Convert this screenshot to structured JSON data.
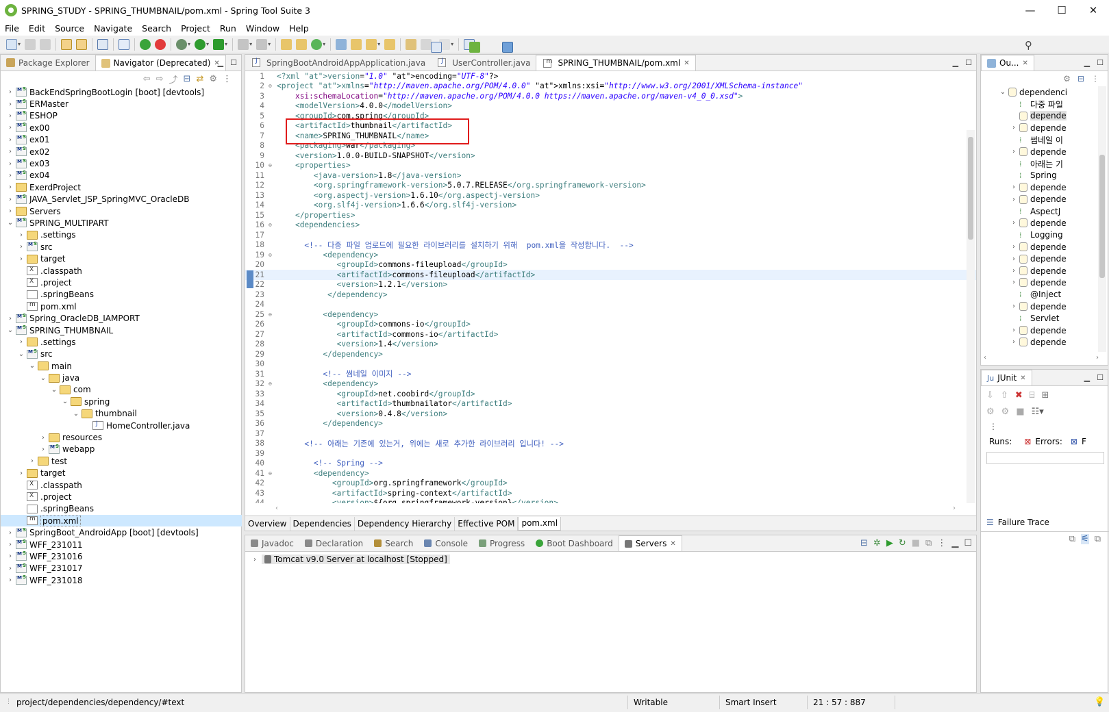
{
  "window": {
    "title": "SPRING_STUDY - SPRING_THUMBNAIL/pom.xml - Spring Tool Suite 3",
    "minimize": "—",
    "maximize": "☐",
    "close": "✕"
  },
  "menu": [
    "File",
    "Edit",
    "Source",
    "Navigate",
    "Search",
    "Project",
    "Run",
    "Window",
    "Help"
  ],
  "left_panel": {
    "tabs": [
      {
        "label": "Package Explorer",
        "active": false
      },
      {
        "label": "Navigator (Deprecated)",
        "active": true
      }
    ],
    "tree": [
      {
        "label": "BackEndSpringBootLogin [boot] [devtools]",
        "level": 0,
        "expand": "›",
        "icon": "project-icon"
      },
      {
        "label": "ERMaster",
        "level": 0,
        "expand": "›",
        "icon": "project-icon"
      },
      {
        "label": "ESHOP",
        "level": 0,
        "expand": "›",
        "icon": "project-icon"
      },
      {
        "label": "ex00",
        "level": 0,
        "expand": "›",
        "icon": "project-icon"
      },
      {
        "label": "ex01",
        "level": 0,
        "expand": "›",
        "icon": "project-icon"
      },
      {
        "label": "ex02",
        "level": 0,
        "expand": "›",
        "icon": "project-icon"
      },
      {
        "label": "ex03",
        "level": 0,
        "expand": "›",
        "icon": "project-icon"
      },
      {
        "label": "ex04",
        "level": 0,
        "expand": "›",
        "icon": "project-icon"
      },
      {
        "label": "ExerdProject",
        "level": 0,
        "expand": "›",
        "icon": "folder-icon"
      },
      {
        "label": "JAVA_Servlet_JSP_SpringMVC_OracleDB",
        "level": 0,
        "expand": "›",
        "icon": "project-icon"
      },
      {
        "label": "Servers",
        "level": 0,
        "expand": "›",
        "icon": "folder-icon"
      },
      {
        "label": "SPRING_MULTIPART",
        "level": 0,
        "expand": "⌄",
        "icon": "project-icon"
      },
      {
        "label": ".settings",
        "level": 1,
        "expand": "›",
        "icon": "folder-icon"
      },
      {
        "label": "src",
        "level": 1,
        "expand": "›",
        "icon": "project-icon"
      },
      {
        "label": "target",
        "level": 1,
        "expand": "›",
        "icon": "folder-icon"
      },
      {
        "label": ".classpath",
        "level": 1,
        "expand": "",
        "icon": "xml-file-icon"
      },
      {
        "label": ".project",
        "level": 1,
        "expand": "",
        "icon": "xml-file-icon"
      },
      {
        "label": ".springBeans",
        "level": 1,
        "expand": "",
        "icon": "text-file-icon"
      },
      {
        "label": "pom.xml",
        "level": 1,
        "expand": "",
        "icon": "maven-file-icon"
      },
      {
        "label": "Spring_OracleDB_IAMPORT",
        "level": 0,
        "expand": "›",
        "icon": "project-icon"
      },
      {
        "label": "SPRING_THUMBNAIL",
        "level": 0,
        "expand": "⌄",
        "icon": "project-icon"
      },
      {
        "label": ".settings",
        "level": 1,
        "expand": "›",
        "icon": "folder-icon"
      },
      {
        "label": "src",
        "level": 1,
        "expand": "⌄",
        "icon": "project-icon"
      },
      {
        "label": "main",
        "level": 2,
        "expand": "⌄",
        "icon": "folder-icon"
      },
      {
        "label": "java",
        "level": 3,
        "expand": "⌄",
        "icon": "folder-icon"
      },
      {
        "label": "com",
        "level": 4,
        "expand": "⌄",
        "icon": "folder-icon"
      },
      {
        "label": "spring",
        "level": 5,
        "expand": "⌄",
        "icon": "folder-icon"
      },
      {
        "label": "thumbnail",
        "level": 6,
        "expand": "⌄",
        "icon": "folder-icon"
      },
      {
        "label": "HomeController.java",
        "level": 7,
        "expand": "",
        "icon": "java-file-icon"
      },
      {
        "label": "resources",
        "level": 3,
        "expand": "›",
        "icon": "folder-icon"
      },
      {
        "label": "webapp",
        "level": 3,
        "expand": "›",
        "icon": "project-icon"
      },
      {
        "label": "test",
        "level": 2,
        "expand": "›",
        "icon": "folder-icon"
      },
      {
        "label": "target",
        "level": 1,
        "expand": "›",
        "icon": "folder-icon"
      },
      {
        "label": ".classpath",
        "level": 1,
        "expand": "",
        "icon": "xml-file-icon"
      },
      {
        "label": ".project",
        "level": 1,
        "expand": "",
        "icon": "xml-file-icon"
      },
      {
        "label": ".springBeans",
        "level": 1,
        "expand": "",
        "icon": "text-file-icon"
      },
      {
        "label": "pom.xml",
        "level": 1,
        "expand": "",
        "icon": "maven-file-icon",
        "selected": true
      },
      {
        "label": "SpringBoot_AndroidApp [boot] [devtools]",
        "level": 0,
        "expand": "›",
        "icon": "project-icon"
      },
      {
        "label": "WFF_231011",
        "level": 0,
        "expand": "›",
        "icon": "project-icon"
      },
      {
        "label": "WFF_231016",
        "level": 0,
        "expand": "›",
        "icon": "project-icon"
      },
      {
        "label": "WFF_231017",
        "level": 0,
        "expand": "›",
        "icon": "project-icon"
      },
      {
        "label": "WFF_231018",
        "level": 0,
        "expand": "›",
        "icon": "project-icon"
      }
    ]
  },
  "editor": {
    "tabs": [
      {
        "label": "SpringBootAndroidAppApplication.java",
        "active": false,
        "icon": "java-file-icon"
      },
      {
        "label": "UserController.java",
        "active": false,
        "icon": "java-file-icon"
      },
      {
        "label": "SPRING_THUMBNAIL/pom.xml",
        "active": true,
        "icon": "maven-file-icon"
      }
    ],
    "lines": [
      {
        "n": "1",
        "fold": "",
        "t": "<?xml version=\"1.0\" encoding=\"UTF-8\"?>"
      },
      {
        "n": "2",
        "fold": "⊖",
        "t": "<project xmlns=\"http://maven.apache.org/POM/4.0.0\" xmlns:xsi=\"http://www.w3.org/2001/XMLSchema-instance\""
      },
      {
        "n": "3",
        "fold": "",
        "t": "    xsi:schemaLocation=\"http://maven.apache.org/POM/4.0.0 https://maven.apache.org/maven-v4_0_0.xsd\">"
      },
      {
        "n": "4",
        "fold": "",
        "t": "    <modelVersion>4.0.0</modelVersion>"
      },
      {
        "n": "5",
        "fold": "",
        "t": "    <groupId>com.spring</groupId>"
      },
      {
        "n": "6",
        "fold": "",
        "t": "    <artifactId>thumbnail</artifactId>"
      },
      {
        "n": "7",
        "fold": "",
        "t": "    <name>SPRING_THUMBNAIL</name>"
      },
      {
        "n": "8",
        "fold": "",
        "t": "    <packaging>war</packaging>"
      },
      {
        "n": "9",
        "fold": "",
        "t": "    <version>1.0.0-BUILD-SNAPSHOT</version>"
      },
      {
        "n": "10",
        "fold": "⊖",
        "t": "    <properties>"
      },
      {
        "n": "11",
        "fold": "",
        "t": "        <java-version>1.8</java-version>"
      },
      {
        "n": "12",
        "fold": "",
        "t": "        <org.springframework-version>5.0.7.RELEASE</org.springframework-version>"
      },
      {
        "n": "13",
        "fold": "",
        "t": "        <org.aspectj-version>1.6.10</org.aspectj-version>"
      },
      {
        "n": "14",
        "fold": "",
        "t": "        <org.slf4j-version>1.6.6</org.slf4j-version>"
      },
      {
        "n": "15",
        "fold": "",
        "t": "    </properties>"
      },
      {
        "n": "16",
        "fold": "⊖",
        "t": "    <dependencies>"
      },
      {
        "n": "17",
        "fold": "",
        "t": ""
      },
      {
        "n": "18",
        "fold": "",
        "t": "      <!-- 다중 파일 업로드에 필요한 라이브러리를 설치하기 위해  pom.xml을 작성합니다.  -->"
      },
      {
        "n": "19",
        "fold": "⊖",
        "t": "          <dependency>"
      },
      {
        "n": "20",
        "fold": "",
        "t": "             <groupId>commons-fileupload</groupId>"
      },
      {
        "n": "21",
        "fold": "",
        "t": "             <artifactId>commons-fileupload</artifactId>",
        "current": true
      },
      {
        "n": "22",
        "fold": "",
        "t": "             <version>1.2.1</version>"
      },
      {
        "n": "23",
        "fold": "",
        "t": "           </dependency>"
      },
      {
        "n": "24",
        "fold": "",
        "t": ""
      },
      {
        "n": "25",
        "fold": "⊖",
        "t": "          <dependency>"
      },
      {
        "n": "26",
        "fold": "",
        "t": "             <groupId>commons-io</groupId>"
      },
      {
        "n": "27",
        "fold": "",
        "t": "             <artifactId>commons-io</artifactId>"
      },
      {
        "n": "28",
        "fold": "",
        "t": "             <version>1.4</version>"
      },
      {
        "n": "29",
        "fold": "",
        "t": "          </dependency>"
      },
      {
        "n": "30",
        "fold": "",
        "t": ""
      },
      {
        "n": "31",
        "fold": "",
        "t": "          <!-- 썸네일 이미지 -->"
      },
      {
        "n": "32",
        "fold": "⊖",
        "t": "          <dependency>"
      },
      {
        "n": "33",
        "fold": "",
        "t": "             <groupId>net.coobird</groupId>"
      },
      {
        "n": "34",
        "fold": "",
        "t": "             <artifactId>thumbnailator</artifactId>"
      },
      {
        "n": "35",
        "fold": "",
        "t": "             <version>0.4.8</version>"
      },
      {
        "n": "36",
        "fold": "",
        "t": "          </dependency>"
      },
      {
        "n": "37",
        "fold": "",
        "t": ""
      },
      {
        "n": "38",
        "fold": "",
        "t": "      <!-- 아래는 기존에 있는거, 위에는 새로 추가한 라이브러리 입니다! -->"
      },
      {
        "n": "39",
        "fold": "",
        "t": ""
      },
      {
        "n": "40",
        "fold": "",
        "t": "        <!-- Spring -->"
      },
      {
        "n": "41",
        "fold": "⊖",
        "t": "        <dependency>"
      },
      {
        "n": "42",
        "fold": "",
        "t": "            <groupId>org.springframework</groupId>"
      },
      {
        "n": "43",
        "fold": "",
        "t": "            <artifactId>spring-context</artifactId>"
      },
      {
        "n": "44",
        "fold": "",
        "t": "            <version>${org.springframework-version}</version>"
      }
    ],
    "pom_tabs": [
      {
        "label": "Overview",
        "active": false
      },
      {
        "label": "Dependencies",
        "active": false
      },
      {
        "label": "Dependency Hierarchy",
        "active": false
      },
      {
        "label": "Effective POM",
        "active": false
      },
      {
        "label": "pom.xml",
        "active": true
      }
    ]
  },
  "outline": {
    "tab": "Ou...",
    "items": [
      {
        "label": "dependenci",
        "level": 0,
        "expand": "⌄",
        "icon": "xml-element-icon"
      },
      {
        "label": "다중 파일",
        "level": 1,
        "expand": "",
        "icon": "comment-icon"
      },
      {
        "label": "depende",
        "level": 1,
        "expand": "",
        "icon": "xml-element-icon",
        "selected": true
      },
      {
        "label": "depende",
        "level": 1,
        "expand": "›",
        "icon": "xml-element-icon"
      },
      {
        "label": "썸네일 이",
        "level": 1,
        "expand": "",
        "icon": "comment-icon"
      },
      {
        "label": "depende",
        "level": 1,
        "expand": "›",
        "icon": "xml-element-icon"
      },
      {
        "label": "아래는 기",
        "level": 1,
        "expand": "",
        "icon": "comment-icon"
      },
      {
        "label": "Spring",
        "level": 1,
        "expand": "",
        "icon": "comment-icon"
      },
      {
        "label": "depende",
        "level": 1,
        "expand": "›",
        "icon": "xml-element-icon"
      },
      {
        "label": "depende",
        "level": 1,
        "expand": "›",
        "icon": "xml-element-icon"
      },
      {
        "label": "AspectJ",
        "level": 1,
        "expand": "",
        "icon": "comment-icon"
      },
      {
        "label": "depende",
        "level": 1,
        "expand": "›",
        "icon": "xml-element-icon"
      },
      {
        "label": "Logging",
        "level": 1,
        "expand": "",
        "icon": "comment-icon"
      },
      {
        "label": "depende",
        "level": 1,
        "expand": "›",
        "icon": "xml-element-icon"
      },
      {
        "label": "depende",
        "level": 1,
        "expand": "›",
        "icon": "xml-element-icon"
      },
      {
        "label": "depende",
        "level": 1,
        "expand": "›",
        "icon": "xml-element-icon"
      },
      {
        "label": "depende",
        "level": 1,
        "expand": "›",
        "icon": "xml-element-icon"
      },
      {
        "label": "@Inject",
        "level": 1,
        "expand": "",
        "icon": "comment-icon"
      },
      {
        "label": "depende",
        "level": 1,
        "expand": "›",
        "icon": "xml-element-icon"
      },
      {
        "label": "Servlet",
        "level": 1,
        "expand": "",
        "icon": "comment-icon"
      },
      {
        "label": "depende",
        "level": 1,
        "expand": "›",
        "icon": "xml-element-icon"
      },
      {
        "label": "depende",
        "level": 1,
        "expand": "›",
        "icon": "xml-element-icon"
      }
    ]
  },
  "junit": {
    "tab": "JUnit",
    "runs_label": "Runs:",
    "errors_label": "Errors:",
    "failures_label": "F",
    "failure_trace": "Failure Trace"
  },
  "bottom": {
    "tabs": [
      {
        "label": "Javadoc",
        "active": false,
        "icon": "javadoc-icon"
      },
      {
        "label": "Declaration",
        "active": false,
        "icon": "declaration-icon"
      },
      {
        "label": "Search",
        "active": false,
        "icon": "search-icon"
      },
      {
        "label": "Console",
        "active": false,
        "icon": "console-icon"
      },
      {
        "label": "Progress",
        "active": false,
        "icon": "progress-icon"
      },
      {
        "label": "Boot Dashboard",
        "active": false,
        "icon": "boot-dashboard-icon"
      },
      {
        "label": "Servers",
        "active": true,
        "icon": "servers-icon"
      }
    ],
    "server_row": "Tomcat v9.0 Server at localhost  [Stopped]"
  },
  "status": {
    "path": "project/dependencies/dependency/#text",
    "writable": "Writable",
    "insert": "Smart Insert",
    "position": "21 : 57 : 887"
  },
  "colors": {
    "tag": "#3f7f7f",
    "attr": "#7f007f",
    "attr_value": "#2a00ff",
    "comment": "#3f5fbf",
    "current_line": "#e8f2fe",
    "highlight_box": "#e01b1b",
    "selection": "#cde8ff"
  }
}
